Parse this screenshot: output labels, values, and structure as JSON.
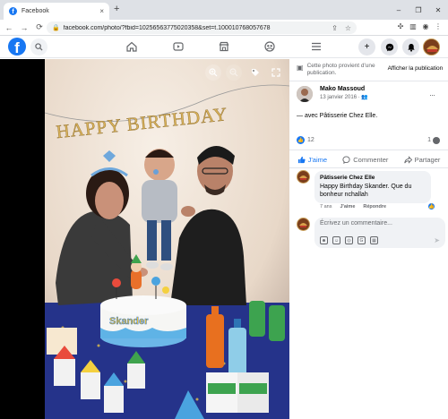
{
  "browser": {
    "tab_title": "Facebook",
    "tab_close": "×",
    "new_tab": "+",
    "url": "facebook.com/photo/?fbid=10256563775020358&set=t.100010768057678",
    "window_controls": [
      "–",
      "❐",
      "✕"
    ],
    "nav": [
      "←",
      "→",
      "⟳"
    ]
  },
  "fbnav": {
    "logo_letter": "f",
    "icons": [
      "home-icon",
      "video-icon",
      "marketplace-icon",
      "groups-icon",
      "menu-icon"
    ],
    "right_buttons": [
      "plus-icon",
      "messenger-icon",
      "bell-icon"
    ]
  },
  "panel": {
    "notice_text": "Cette photo provient d'une publication.",
    "notice_button": "Afficher la publication",
    "author_name": "Mako Massoud",
    "post_date": "13 janvier 2016 ·",
    "more": "···",
    "caption": "— avec Pâtisserie Chez Elle.",
    "likes_count": "12",
    "comments_count": "1",
    "like_label": "J'aime",
    "comment_label": "Commenter",
    "share_label": "Partager"
  },
  "comment": {
    "author": "Pâtisserie Chez Elle",
    "text": "Happy Birthday Skander. Que du bonheur nchallah",
    "age": "7 ans",
    "like": "J'aime",
    "reply": "Répondre"
  },
  "composer": {
    "placeholder": "Écrivez un commentaire..."
  },
  "photo": {
    "banner": "HAPPY BIRTHDAY",
    "cake_text": "Skander"
  }
}
